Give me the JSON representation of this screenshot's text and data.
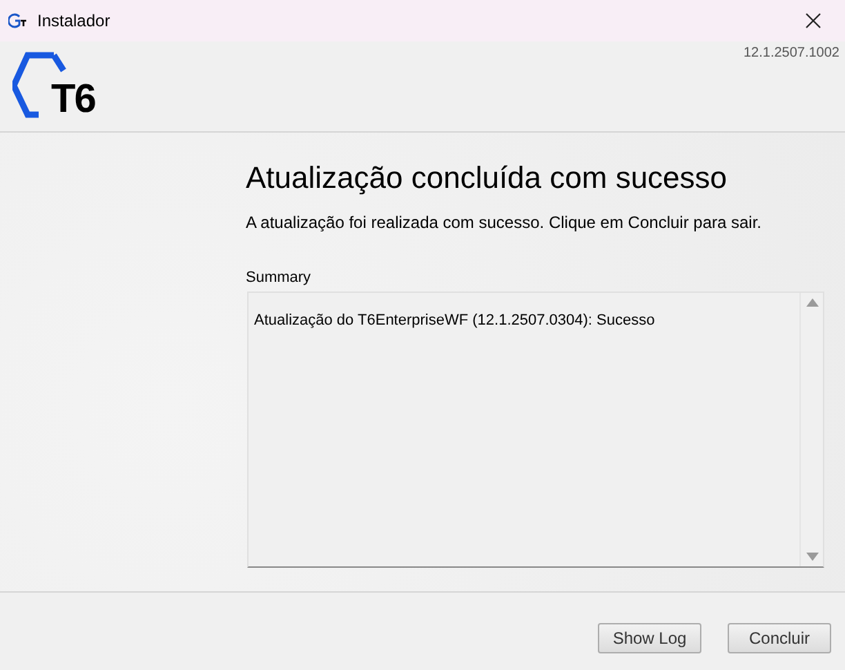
{
  "window": {
    "title": "Instalador",
    "version": "12.1.2507.1002"
  },
  "logo": {
    "text": "T6"
  },
  "heading": "Atualização concluída com sucesso",
  "description": "A atualização foi realizada com sucesso. Clique em Concluir para sair.",
  "summary": {
    "label": "Summary",
    "lines": [
      "Atualização do T6EnterpriseWF (12.1.2507.0304): Sucesso"
    ]
  },
  "buttons": [
    {
      "label": "Show Log"
    },
    {
      "label": "Concluir"
    }
  ]
}
